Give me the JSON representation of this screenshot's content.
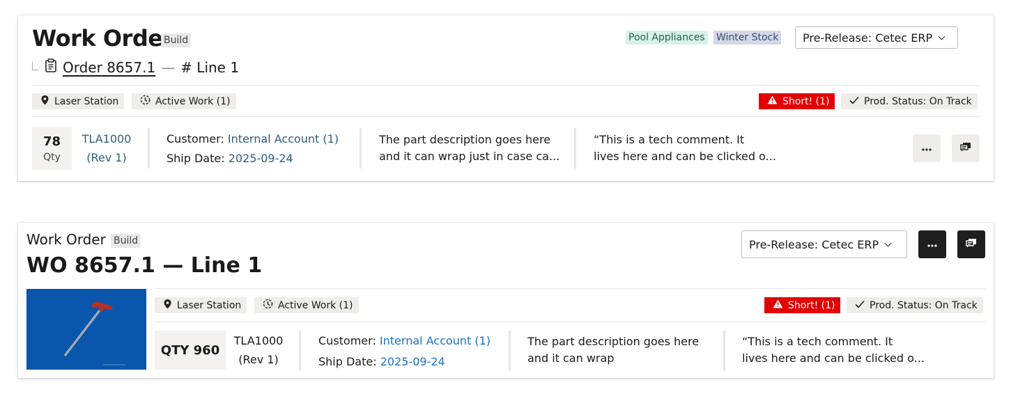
{
  "card1": {
    "title": "Work Order",
    "badge": "Build",
    "breadcrumb": {
      "order": "Order 8657.1",
      "dash": "—",
      "line": "# Line 1"
    },
    "tags": [
      "Pool Appliances",
      "Winter Stock"
    ],
    "select_value": "Pre-Release: Cetec ERP",
    "chips": {
      "location": "Laser Station",
      "activity": "Active Work (1)",
      "short": "Short! (1)",
      "status": "Prod. Status: On Track"
    },
    "qty_value": "78",
    "qty_unit": "Qty",
    "part": "TLA1000",
    "rev": "(Rev 1)",
    "customer_label": "Customer:",
    "customer_value": "Internal Account (1)",
    "ship_label": "Ship Date:",
    "ship_value": "2025-09-24",
    "description_1": "The part description goes here",
    "description_2": "and it can wrap just in case ca...",
    "comment_1": "“This is a tech comment. It",
    "comment_2": "lives here and can be clicked o..."
  },
  "card2": {
    "title_small": "Work Order",
    "badge": "Build",
    "title": "WO 8657.1 — Line 1",
    "select_value": "Pre-Release: Cetec ERP",
    "chips": {
      "location": "Laser Station",
      "activity": "Active Work (1)",
      "short": "Short! (1)",
      "status": "Prod. Status: On Track"
    },
    "qty": "QTY 960",
    "part": "TLA1000",
    "rev": "(Rev 1)",
    "customer_label": "Customer:",
    "customer_value": "Internal Account (1)",
    "ship_label": "Ship Date:",
    "ship_value": "2025-09-24",
    "description_1": "The part description goes here",
    "description_2": "and it can wrap",
    "comment_1": "“This is a tech comment. It",
    "comment_2": "lives here and can be clicked o..."
  },
  "icons": [
    "clipboard-icon",
    "map-pin-icon",
    "clock-dashed-icon",
    "warning-icon",
    "check-icon",
    "ellipsis-icon",
    "comments-icon",
    "chevron-down-icon"
  ],
  "colors": {
    "short_red": "#e30000",
    "tag_green_bg": "#d5f2e6",
    "tag_purple_bg": "#d3d8e8",
    "link_teal": "#2e5e75",
    "link_blue": "#1a73c8",
    "dark_button": "#1e1e1e",
    "photo_bg": "#0a56ac"
  }
}
